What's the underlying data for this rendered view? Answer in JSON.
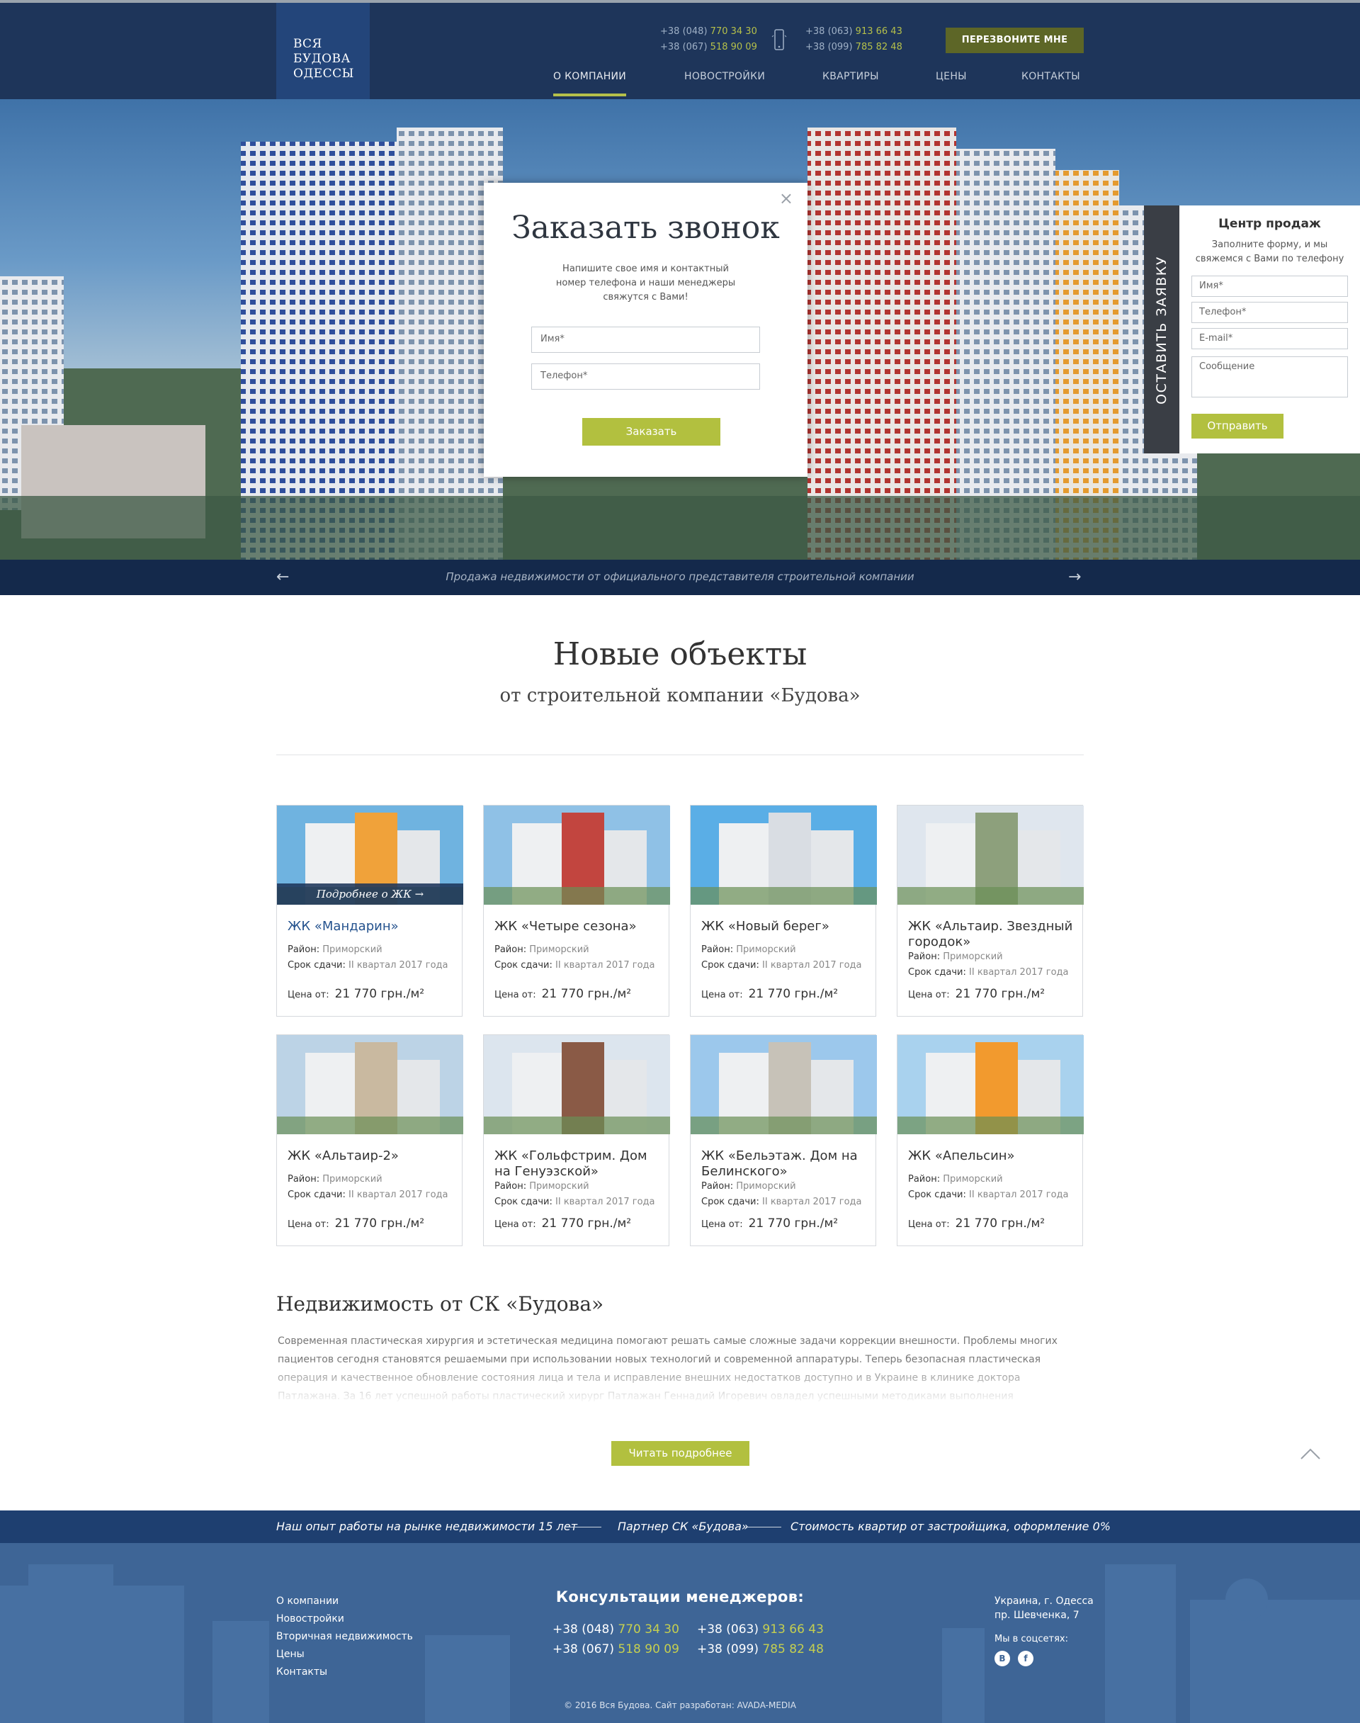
{
  "header": {
    "logo": [
      "ВСЯ",
      "БУДОВА",
      "ОДЕССЫ"
    ],
    "phones_left": [
      {
        "prefix": "+38 (048)",
        "number": "770 34 30"
      },
      {
        "prefix": "+38 (067)",
        "number": "518 90 09"
      }
    ],
    "phones_right": [
      {
        "prefix": "+38 (063)",
        "number": "913 66 43"
      },
      {
        "prefix": "+38 (099)",
        "number": "785 82 48"
      }
    ],
    "callback_label": "ПЕРЕЗВОНИТЕ МНЕ",
    "nav": [
      "О КОМПАНИИ",
      "НОВОСТРОЙКИ",
      "КВАРТИРЫ",
      "ЦЕНЫ",
      "КОНТАКТЫ"
    ],
    "active_nav": "О КОМПАНИИ"
  },
  "hero": {
    "caption": "Продажа недвижимости от официального представителя строительной компании",
    "prev_icon": "arrow-left-icon",
    "next_icon": "arrow-right-icon"
  },
  "modal": {
    "title": "Заказать звонок",
    "text": "Напишите свое имя и контактный номер телефона и наши менеджеры свяжутся с Вами!",
    "name_placeholder": "Имя*",
    "phone_placeholder": "Телефон*",
    "submit_label": "Заказать",
    "close_icon": "close-icon"
  },
  "side_form": {
    "tab_label": "ОСТАВИТЬ ЗАЯВКУ",
    "title": "Центр продаж",
    "text": "Заполните форму, и мы свяжемся с Вами по телефону",
    "name_placeholder": "Имя*",
    "phone_placeholder": "Телефон*",
    "email_placeholder": "E-mail*",
    "message_placeholder": "Сообщение",
    "submit_label": "Отправить"
  },
  "new_objects": {
    "title": "Новые объекты",
    "subtitle": "от строительной компании «Будова»",
    "more_label": "Подробнее о ЖК",
    "district_label": "Район:",
    "deadline_label": "Срок сдачи:",
    "price_label": "Цена от:",
    "cards": [
      {
        "title": "ЖК «Мандарин»",
        "district": "Приморский",
        "deadline": "II квартал 2017 года",
        "price": "21 770 грн./м²"
      },
      {
        "title": "ЖК «Четыре сезона»",
        "district": "Приморский",
        "deadline": "II квартал 2017 года",
        "price": "21 770 грн./м²"
      },
      {
        "title": "ЖК «Новый берег»",
        "district": "Приморский",
        "deadline": "II квартал 2017 года",
        "price": "21 770 грн./м²"
      },
      {
        "title": "ЖК «Альтаир. Звездный городок»",
        "district": "Приморский",
        "deadline": "II квартал 2017 года",
        "price": "21 770 грн./м²"
      },
      {
        "title": "ЖК «Альтаир-2»",
        "district": "Приморский",
        "deadline": "II квартал 2017 года",
        "price": "21 770 грн./м²"
      },
      {
        "title": "ЖК «Гольфстрим. Дом на Генуэзской»",
        "district": "Приморский",
        "deadline": "II квартал 2017 года",
        "price": "21 770 грн./м²"
      },
      {
        "title": "ЖК «Бельэтаж. Дом на Белинского»",
        "district": "Приморский",
        "deadline": "II квартал 2017 года",
        "price": "21 770 грн./м²"
      },
      {
        "title": "ЖК «Апельсин»",
        "district": "Приморский",
        "deadline": "II квартал 2017 года",
        "price": "21 770 грн./м²"
      }
    ]
  },
  "about": {
    "title": "Недвижимость от СК «Будова»",
    "text": "Современная пластическая хирургия и эстетическая медицина помогают решать самые сложные задачи коррекции внешности. Проблемы многих пациентов сегодня становятся решаемыми при использовании новых технологий и современной аппаратуры. Теперь безопасная пластическая операция  и качественное обновление состояния лица и тела и исправление внешних недостатков доступно и в Украине в клинике доктора Патлажана. За 16 лет успешной работы пластический хирург Патлажан Геннадий Игоревич овладел успешными методиками выполнения пластических операций и поставил их на службу людям.",
    "read_more_label": "Читать подробнее",
    "scroll_top_icon": "chevron-up-icon"
  },
  "strip": {
    "items": [
      "Наш опыт работы на рынке недвижимости 15 лет",
      "Партнер СК «Будова»",
      "Стоимость квартир от застройщика, оформление 0%"
    ]
  },
  "footer": {
    "links": [
      "О компании",
      "Новостройки",
      "Вторичная недвижимость",
      "Цены",
      "Контакты"
    ],
    "consult_title": "Консультации менеджеров:",
    "phones_left": [
      {
        "prefix": "+38 (048)",
        "number": "770 34 30"
      },
      {
        "prefix": "+38 (067)",
        "number": "518 90 09"
      }
    ],
    "phones_right": [
      {
        "prefix": "+38 (063)",
        "number": "913 66 43"
      },
      {
        "prefix": "+38 (099)",
        "number": "785 82 48"
      }
    ],
    "address": [
      "Украина, г. Одесса",
      "пр. Шевченка, 7"
    ],
    "social_label": "Мы в соцсетях:",
    "social": [
      "В",
      "f"
    ],
    "copyright": "© 2016 Вся Будова. Сайт разработан: AVADA-MEDIA"
  },
  "colors": {
    "header_bg": "#1e355a",
    "accent_green": "#b2c03f",
    "footer_bg": "#3e6596",
    "strip_bg": "#1e3f70",
    "link_blue": "#24528e"
  }
}
